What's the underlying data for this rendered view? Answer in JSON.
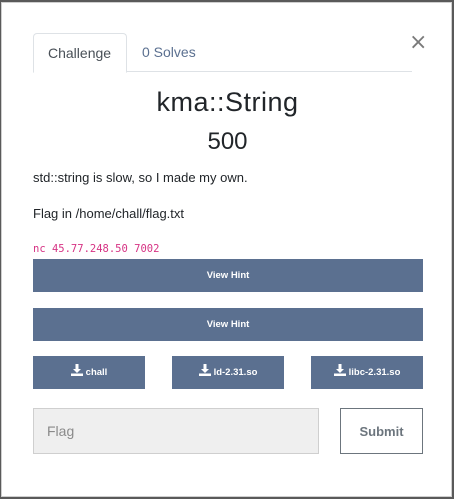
{
  "modal": {
    "close_glyph": "×",
    "tabs": [
      {
        "label": "Challenge",
        "active": true
      },
      {
        "label": "0 Solves",
        "active": false
      }
    ],
    "challenge": {
      "name": "kma::String",
      "value": "500",
      "description": [
        "std::string is slow, so I made my own.",
        "Flag in /home/chall/flag.txt"
      ],
      "connection": "nc 45.77.248.50 7002"
    },
    "hints": [
      {
        "label": "View Hint"
      },
      {
        "label": "View Hint"
      }
    ],
    "files": [
      {
        "label": "chall",
        "icon": "download-icon"
      },
      {
        "label": "ld-2.31.so",
        "icon": "download-icon"
      },
      {
        "label": "libc-2.31.so",
        "icon": "download-icon"
      }
    ],
    "flag_input": {
      "placeholder": "Flag",
      "value": ""
    },
    "submit_label": "Submit"
  },
  "colors": {
    "button_bg": "#5b7090",
    "link": "#5b7090",
    "code": "#d63384",
    "backdrop": "#5a5a5a"
  }
}
